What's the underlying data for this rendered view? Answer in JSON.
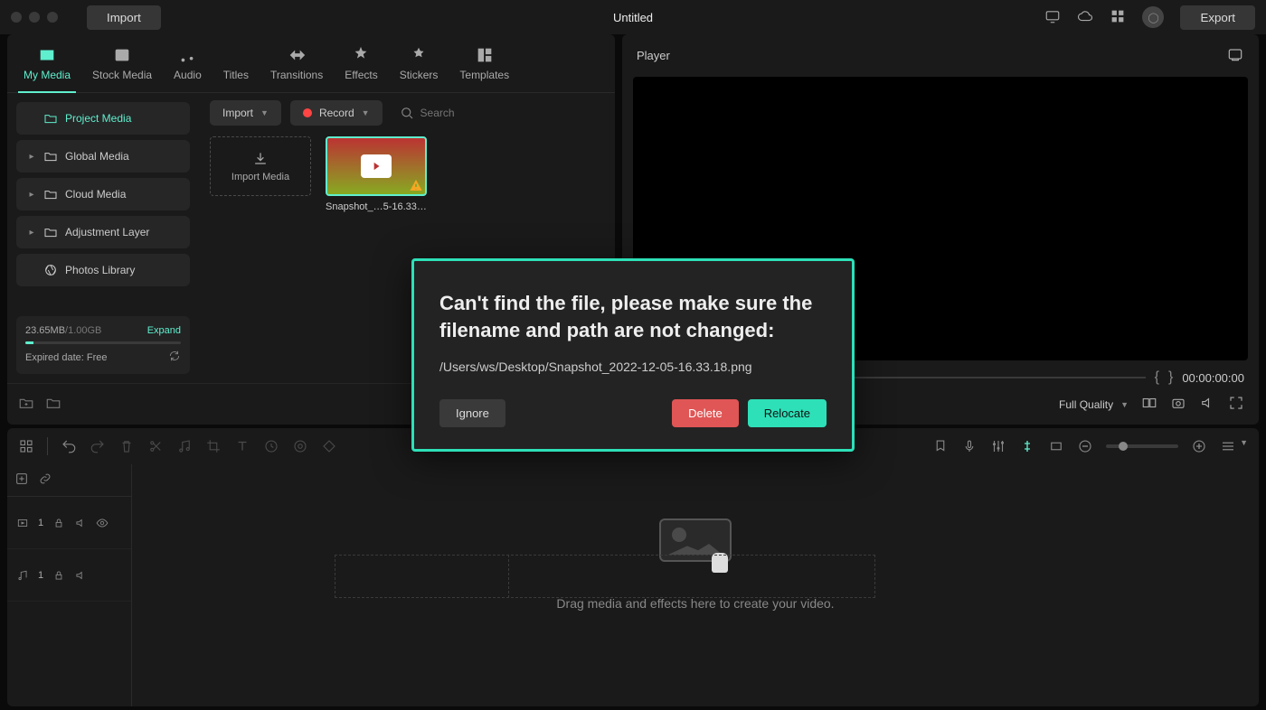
{
  "title": "Untitled",
  "top": {
    "import": "Import",
    "export": "Export"
  },
  "tabs": [
    {
      "label": "My Media"
    },
    {
      "label": "Stock Media"
    },
    {
      "label": "Audio"
    },
    {
      "label": "Titles"
    },
    {
      "label": "Transitions"
    },
    {
      "label": "Effects"
    },
    {
      "label": "Stickers"
    },
    {
      "label": "Templates"
    }
  ],
  "sidebar": {
    "items": [
      {
        "label": "Project Media",
        "expandable": false,
        "active": true
      },
      {
        "label": "Global Media",
        "expandable": true
      },
      {
        "label": "Cloud Media",
        "expandable": true
      },
      {
        "label": "Adjustment Layer",
        "expandable": true
      },
      {
        "label": "Photos Library",
        "expandable": false,
        "icon": "aperture"
      }
    ],
    "storage": {
      "used": "23.65MB",
      "total": "/1.00GB",
      "expand": "Expand",
      "expired_prefix": "Expired date: ",
      "expired_value": "Free"
    }
  },
  "media_toolbar": {
    "import": "Import",
    "record": "Record",
    "search_placeholder": "Search"
  },
  "media": {
    "import_tile": "Import Media",
    "items": [
      {
        "name": "Snapshot_…5-16.33.18"
      }
    ]
  },
  "player": {
    "title": "Player",
    "timecode": "00:00:00:00",
    "quality": "Full Quality"
  },
  "tracks": [
    {
      "kind": "video",
      "index": "1"
    },
    {
      "kind": "audio",
      "index": "1"
    }
  ],
  "timeline_hint": "Drag media and effects here to create your video.",
  "modal": {
    "title": "Can't find the file, please make sure the filename and path are not changed:",
    "path": "/Users/ws/Desktop/Snapshot_2022-12-05-16.33.18.png",
    "ignore": "Ignore",
    "delete": "Delete",
    "relocate": "Relocate"
  }
}
